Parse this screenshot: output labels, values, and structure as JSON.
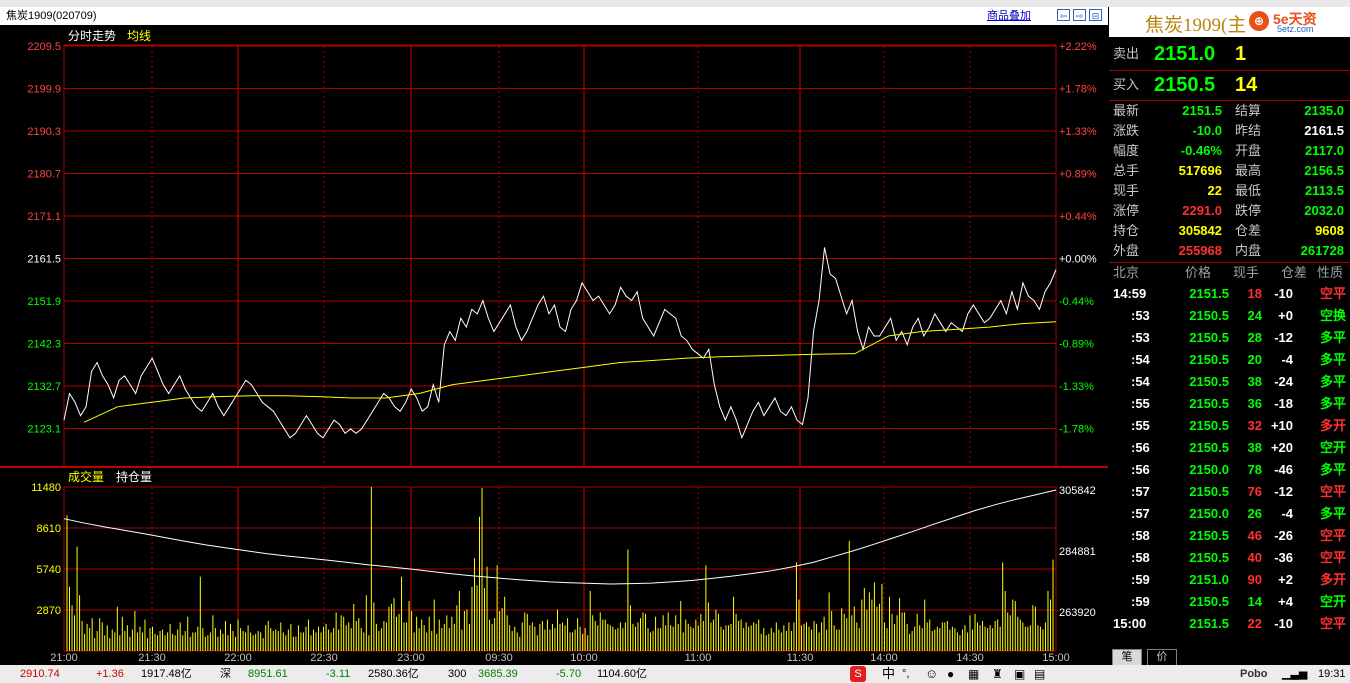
{
  "title_bar": {
    "title": "焦炭1909(020709)",
    "overlay_label": "商品叠加",
    "nav_left": "⇦",
    "nav_right": "⇨",
    "nav_toggle": "⊟"
  },
  "price_panel": {
    "label_intraday": "分时走势",
    "label_avg": "均线",
    "y_labels": [
      {
        "v": "2209.5",
        "c": "r",
        "pct": "+2.22%"
      },
      {
        "v": "2199.9",
        "c": "r",
        "pct": "+1.78%"
      },
      {
        "v": "2190.3",
        "c": "r",
        "pct": "+1.33%"
      },
      {
        "v": "2180.7",
        "c": "r",
        "pct": "+0.89%"
      },
      {
        "v": "2171.1",
        "c": "r",
        "pct": "+0.44%"
      },
      {
        "v": "2161.5",
        "c": "w",
        "pct": "+0.00%"
      },
      {
        "v": "2151.9",
        "c": "g",
        "pct": "-0.44%"
      },
      {
        "v": "2142.3",
        "c": "g",
        "pct": "-0.89%"
      },
      {
        "v": "2132.7",
        "c": "g",
        "pct": "-1.33%"
      },
      {
        "v": "2123.1",
        "c": "g",
        "pct": "-1.78%"
      }
    ]
  },
  "volume_panel": {
    "label_volume": "成交量",
    "label_oi": "持仓量",
    "left_labels": [
      "11480",
      "8610",
      "5740",
      "2870"
    ],
    "right_labels": [
      "305842",
      "284881",
      "263920"
    ]
  },
  "x_labels": [
    "21:00",
    "21:30",
    "22:00",
    "22:30",
    "23:00",
    "09:30",
    "10:00",
    "11:00",
    "11:30",
    "14:00",
    "14:30",
    "15:00"
  ],
  "quote": {
    "name": "焦炭1909(主",
    "logo_mark": "⊕",
    "logo_text": "5e天资",
    "logo_sub": "5etz.com",
    "sell_label": "卖出",
    "sell_price": "2151.0",
    "sell_qty": "1",
    "buy_label": "买入",
    "buy_price": "2150.5",
    "buy_qty": "14",
    "stats": [
      {
        "l1": "最新",
        "v1": "2151.5",
        "c1": "g",
        "l2": "结算",
        "v2": "2135.0",
        "c2": "g"
      },
      {
        "l1": "涨跌",
        "v1": "-10.0",
        "c1": "g",
        "l2": "昨结",
        "v2": "2161.5",
        "c2": "w"
      },
      {
        "l1": "幅度",
        "v1": "-0.46%",
        "c1": "g",
        "l2": "开盘",
        "v2": "2117.0",
        "c2": "g"
      },
      {
        "l1": "总手",
        "v1": "517696",
        "c1": "y",
        "l2": "最高",
        "v2": "2156.5",
        "c2": "g"
      },
      {
        "l1": "现手",
        "v1": "22",
        "c1": "y",
        "l2": "最低",
        "v2": "2113.5",
        "c2": "g"
      },
      {
        "l1": "涨停",
        "v1": "2291.0",
        "c1": "r",
        "l2": "跌停",
        "v2": "2032.0",
        "c2": "g"
      },
      {
        "l1": "持仓",
        "v1": "305842",
        "c1": "y",
        "l2": "仓差",
        "v2": "9608",
        "c2": "y"
      },
      {
        "l1": "外盘",
        "v1": "255968",
        "c1": "r",
        "l2": "内盘",
        "v2": "261728",
        "c2": "g"
      }
    ],
    "ticks_header": {
      "h0": "北京",
      "h1": "价格",
      "h2": "现手",
      "h3": "仓差",
      "h4": "性质"
    },
    "ticks": [
      {
        "t": "14:59",
        "p": "2151.5",
        "q": "18",
        "qc": "r",
        "d": "-10",
        "dc": "w",
        "n": "空平",
        "nc": "r"
      },
      {
        "t": ":53",
        "p": "2150.5",
        "q": "24",
        "qc": "g",
        "d": "+0",
        "dc": "w",
        "n": "空换",
        "nc": "g"
      },
      {
        "t": ":53",
        "p": "2150.5",
        "q": "28",
        "qc": "g",
        "d": "-12",
        "dc": "w",
        "n": "多平",
        "nc": "g"
      },
      {
        "t": ":54",
        "p": "2150.5",
        "q": "20",
        "qc": "g",
        "d": "-4",
        "dc": "w",
        "n": "多平",
        "nc": "g"
      },
      {
        "t": ":54",
        "p": "2150.5",
        "q": "38",
        "qc": "g",
        "d": "-24",
        "dc": "w",
        "n": "多平",
        "nc": "g"
      },
      {
        "t": ":55",
        "p": "2150.5",
        "q": "36",
        "qc": "g",
        "d": "-18",
        "dc": "w",
        "n": "多平",
        "nc": "g"
      },
      {
        "t": ":55",
        "p": "2150.5",
        "q": "32",
        "qc": "r",
        "d": "+10",
        "dc": "w",
        "n": "多开",
        "nc": "r"
      },
      {
        "t": ":56",
        "p": "2150.5",
        "q": "38",
        "qc": "g",
        "d": "+20",
        "dc": "w",
        "n": "空开",
        "nc": "g"
      },
      {
        "t": ":56",
        "p": "2150.0",
        "q": "78",
        "qc": "g",
        "d": "-46",
        "dc": "w",
        "n": "多平",
        "nc": "g"
      },
      {
        "t": ":57",
        "p": "2150.5",
        "q": "76",
        "qc": "r",
        "d": "-12",
        "dc": "w",
        "n": "空平",
        "nc": "r"
      },
      {
        "t": ":57",
        "p": "2150.0",
        "q": "26",
        "qc": "g",
        "d": "-4",
        "dc": "w",
        "n": "多平",
        "nc": "g"
      },
      {
        "t": ":58",
        "p": "2150.5",
        "q": "46",
        "qc": "r",
        "d": "-26",
        "dc": "w",
        "n": "空平",
        "nc": "r"
      },
      {
        "t": ":58",
        "p": "2150.5",
        "q": "40",
        "qc": "r",
        "d": "-36",
        "dc": "w",
        "n": "空平",
        "nc": "r"
      },
      {
        "t": ":59",
        "p": "2151.0",
        "q": "90",
        "qc": "r",
        "d": "+2",
        "dc": "w",
        "n": "多开",
        "nc": "r"
      },
      {
        "t": ":59",
        "p": "2150.5",
        "q": "14",
        "qc": "g",
        "d": "+4",
        "dc": "w",
        "n": "空开",
        "nc": "g"
      },
      {
        "t": "15:00",
        "p": "2151.5",
        "q": "22",
        "qc": "r",
        "d": "-10",
        "dc": "w",
        "n": "空平",
        "nc": "r"
      }
    ],
    "tab_trades": "笔",
    "tab_price": "价"
  },
  "status_bar": {
    "idx1": "2910.74",
    "chg1": "+1.36",
    "amt1": "1917.48亿",
    "mkt2": "深",
    "idx2": "8951.61",
    "chg2": "-3.11",
    "amt2": "2580.36亿",
    "mkt3": "300",
    "idx3": "3685.39",
    "chg3": "-5.70",
    "amt3": "1104.60亿",
    "ime": "中",
    "brand": "Pobo",
    "clock": "19:31"
  },
  "colors": {
    "red_grid": "#b00000",
    "price_line": "#ffffff",
    "avg_line": "#ffff00",
    "volume_bar": "#ffff00",
    "up": "#ff3030",
    "down": "#00ff00"
  },
  "chart_data": {
    "type": "line",
    "price_ylim": [
      2113.5,
      2209.5
    ],
    "prev_settle": 2161.5,
    "price_series": {
      "name": "分时走势",
      "values": [
        2125,
        2131,
        2129,
        2126,
        2128,
        2136,
        2138,
        2135,
        2133,
        2130,
        2134,
        2135,
        2133,
        2131,
        2135,
        2137,
        2139,
        2136,
        2133,
        2131,
        2133,
        2135,
        2132,
        2130,
        2128,
        2127,
        2129,
        2131,
        2128,
        2126,
        2128,
        2130,
        2132,
        2134,
        2133,
        2131,
        2129,
        2128,
        2127,
        2125,
        2123,
        2121,
        2122,
        2124,
        2126,
        2124,
        2122,
        2121,
        2123,
        2125,
        2124,
        2122,
        2123,
        2122,
        2123,
        2125,
        2127,
        2129,
        2131,
        2130,
        2128,
        2127,
        2129,
        2132,
        2130,
        2127,
        2128,
        2133,
        2129,
        2142,
        2145,
        2143,
        2148,
        2146,
        2150,
        2149,
        2152,
        2148,
        2145,
        2147,
        2149,
        2151,
        2146,
        2143,
        2145,
        2148,
        2151,
        2153,
        2149,
        2151,
        2146,
        2145,
        2150,
        2152,
        2156,
        2154,
        2152,
        2153,
        2151,
        2149,
        2151,
        2155,
        2153,
        2152,
        2154,
        2148,
        2146,
        2144,
        2147,
        2150,
        2149,
        2148,
        2144,
        2143,
        2141,
        2140,
        2139,
        2141,
        2133,
        2128,
        2125,
        2128,
        2125,
        2121,
        2124,
        2127,
        2129,
        2126,
        2128,
        2130,
        2127,
        2126,
        2128,
        2125,
        2124,
        2130,
        2145,
        2152,
        2164,
        2158,
        2157,
        2153,
        2149,
        2152,
        2145,
        2141,
        2146,
        2144,
        2144,
        2146,
        2148,
        2143,
        2145,
        2142,
        2146,
        2148,
        2144,
        2146,
        2149,
        2147,
        2145,
        2147,
        2146,
        2145,
        2149,
        2151,
        2149,
        2147,
        2148,
        2150,
        2152,
        2149,
        2154,
        2150,
        2156,
        2153,
        2152,
        2150,
        2154,
        2156,
        2159
      ]
    },
    "avg_series": {
      "name": "均线",
      "values": [
        2124.5,
        2128,
        2129,
        2130,
        2130.3,
        2130.5,
        2130.5,
        2130.3,
        2130,
        2130,
        2131,
        2133,
        2134,
        2135,
        2136,
        2137,
        2138,
        2138.5,
        2139,
        2139.3,
        2139.5,
        2139.7,
        2139.9,
        2140,
        2144,
        2145,
        2145.5,
        2146,
        2146.8,
        2147.2
      ]
    },
    "oi_series": {
      "name": "持仓量",
      "values": [
        296000,
        294500,
        293200,
        292000,
        290800,
        289500,
        288200,
        287000,
        286000,
        285000,
        284000,
        283200,
        282500,
        281800,
        281000,
        280200,
        279500,
        278800,
        278000,
        277200,
        276500,
        275900,
        275300,
        274800,
        274300,
        274000,
        273800,
        273600,
        273700,
        273900,
        274300,
        274800,
        275500,
        276300,
        277200,
        278200,
        279500,
        281000,
        283000,
        285000,
        287200,
        289500,
        291800,
        294200,
        296500,
        298800,
        300800,
        302600,
        304200,
        305842
      ]
    },
    "volume_ylim": [
      0,
      11480
    ],
    "volume_series": {
      "name": "成交量",
      "values": [
        9500,
        4500,
        3200,
        2500,
        7300,
        3900,
        2100,
        1200,
        1900,
        1600,
        2300,
        900,
        1400,
        2300,
        2000,
        1100,
        1800,
        900,
        1500,
        1300,
        3100,
        1100,
        2400,
        1400,
        1800,
        1000,
        1500,
        2800,
        1300,
        1700,
        1300,
        2200,
        900,
        1600,
        1700,
        1200,
        1100,
        1400,
        1500,
        1100,
        1300,
        1900,
        1200,
        1100,
        1500,
        2000,
        1100,
        1400,
        2400,
        1000,
        1300,
        1300,
        1700,
        5200,
        1600,
        1000,
        1100,
        1300,
        2500,
        1600,
        1000,
        1500,
        1200,
        2100,
        1100,
        1900,
        1400,
        1000,
        2200,
        1600,
        1400,
        1300,
        1800,
        1300,
        1100,
        1200,
        1400,
        1300,
        900,
        1800,
        2100,
        1600,
        1400,
        1500,
        1400,
        2000,
        1300,
        1100,
        1500,
        1900,
        1000,
        1000,
        1800,
        1300,
        1300,
        1700,
        2200,
        1100,
        1500,
        1300,
        1700,
        1300,
        1700,
        1900,
        1500,
        1300,
        1600,
        2700,
        1500,
        2500,
        2400,
        1800,
        2000,
        1600,
        3300,
        2100,
        2300,
        1600,
        1300,
        3900,
        1100,
        12000,
        3400,
        1900,
        1400,
        1600,
        2100,
        2000,
        3100,
        3300,
        3700,
        2400,
        2600,
        5200,
        2000,
        2000,
        3500,
        2800,
        1300,
        2400,
        1600,
        2200,
        1800,
        1300,
        2400,
        1400,
        3600,
        1200,
        2200,
        1600,
        1900,
        2500,
        1600,
        2400,
        1900,
        3200,
        4200,
        1500,
        2800,
        2900,
        1900,
        4500,
        6500,
        4600,
        9400,
        11400,
        4400,
        5900,
        2200,
        1900,
        2300,
        6000,
        2800,
        3000,
        3800,
        2500,
        1800,
        1400,
        1700,
        1300,
        1000,
        2000,
        2700,
        2600,
        1800,
        2000,
        1700,
        1100,
        1900,
        2100,
        1500,
        2200,
        1500,
        1900,
        1600,
        2900,
        1900,
        2000,
        1800,
        2300,
        1300,
        1300,
        1500,
        2300,
        1700,
        1200,
        1600,
        1100,
        4200,
        2500,
        2100,
        1800,
        2700,
        2200,
        2200,
        1900,
        1800,
        1700,
        1500,
        1600,
        2000,
        1600,
        2000,
        7100,
        3200,
        1900,
        1700,
        2000,
        2300,
        2700,
        2600,
        1600,
        1300,
        1400,
        2400,
        1600,
        1600,
        2500,
        1800,
        2700,
        1800,
        1700,
        2500,
        1900,
        3500,
        1300,
        2200,
        1900,
        1700,
        1600,
        2200,
        1800,
        2600,
        2100,
        6000,
        3400,
        2000,
        2200,
        2900,
        2600,
        1700,
        1500,
        1800,
        1800,
        1900,
        3800,
        2600,
        2100,
        2200,
        1600,
        2000,
        1700,
        1800,
        2000,
        1900,
        2200,
        1200,
        1600,
        1100,
        1200,
        1600,
        1300,
        2000,
        1500,
        1300,
        1800,
        1400,
        2000,
        1400,
        2000,
        6200,
        3600,
        1800,
        1900,
        2000,
        1700,
        1500,
        2100,
        1900,
        1300,
        2000,
        2400,
        1500,
        4100,
        2800,
        1800,
        1500,
        1500,
        3000,
        2600,
        2300,
        7700,
        2500,
        3100,
        2000,
        1600,
        3600,
        4400,
        2900,
        4100,
        3600,
        4800,
        3100,
        3300,
        4700,
        2000,
        1600,
        3800,
        2600,
        1900,
        2500,
        3700,
        2700,
        2700,
        1900,
        1200,
        1400,
        1700,
        2600,
        1800,
        1600,
        3600,
        2000,
        2200,
        1400,
        1500,
        1700,
        1600,
        2000,
        2000,
        2100,
        1500,
        1700,
        1600,
        1300,
        1100,
        1500,
        1800,
        1300,
        2500,
        1500,
        2600,
        2000,
        1800,
        2100,
        1700,
        1600,
        1800,
        1600,
        2100,
        2200,
        1700,
        6200,
        4200,
        2700,
        2500,
        3600,
        3500,
        2400,
        2200,
        2000,
        1700,
        1700,
        1800,
        3200,
        3100,
        1800,
        1700,
        1500,
        2000,
        4200,
        3600,
        6400
      ]
    },
    "x_labels": [
      "21:00",
      "21:30",
      "22:00",
      "22:30",
      "23:00",
      "09:30",
      "10:00",
      "11:00",
      "11:30",
      "14:00",
      "14:30",
      "15:00"
    ]
  }
}
